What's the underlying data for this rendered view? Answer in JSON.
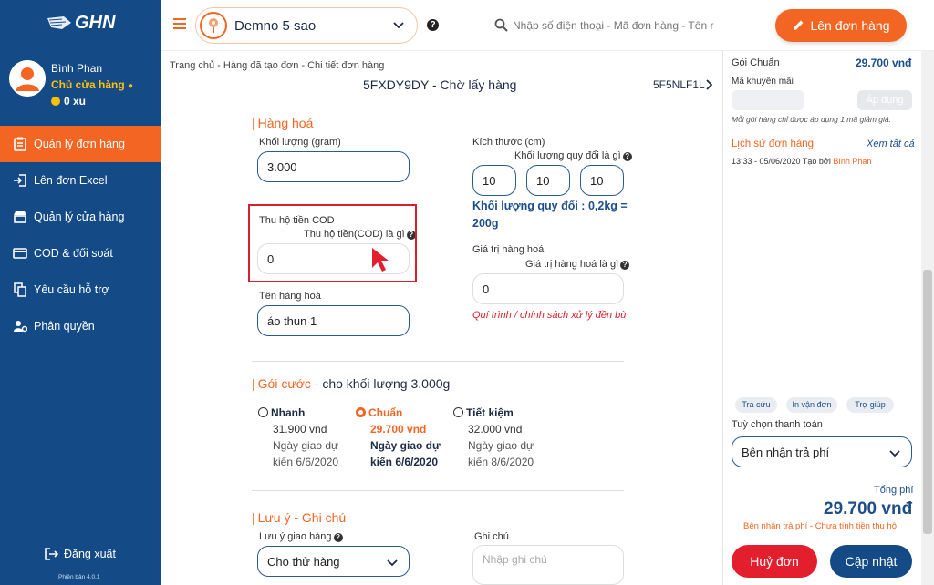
{
  "brand": {
    "logo_text": "GHN"
  },
  "profile": {
    "name": "Bình Phan",
    "role": "Chủ cửa hàng",
    "coins": "0 xu"
  },
  "sidebar": {
    "items": [
      {
        "label": "Quản lý đơn hàng",
        "icon": "clipboard-icon",
        "active": true
      },
      {
        "label": "Lên đơn Excel",
        "icon": "import-icon"
      },
      {
        "label": "Quản lý cửa hàng",
        "icon": "store-icon"
      },
      {
        "label": "COD & đối soát",
        "icon": "card-icon"
      },
      {
        "label": "Yêu cầu hỗ trợ",
        "icon": "documents-icon"
      },
      {
        "label": "Phân quyền",
        "icon": "users-gear-icon"
      }
    ],
    "logout": "Đăng xuất",
    "version": "Phiên bản 4.0.1"
  },
  "topbar": {
    "shop": "Demno 5 sao",
    "search_placeholder": "Nhập số điện thoại - Mã đơn hàng - Tên r",
    "create_button": "Lên đơn hàng"
  },
  "breadcrumb": "Trang chủ - Hàng đã tạo đơn - Chi tiết đơn hàng",
  "order": {
    "title": "5FXDY9DY - Chờ lấy hàng",
    "code": "5F5NLF1L"
  },
  "goods": {
    "section": "Hàng hoá",
    "weight_label": "Khối lượng (gram)",
    "weight_value": "3.000",
    "size_label": "Kích thước (cm)",
    "size_help": "Khối lượng quy đổi là gì",
    "dims": [
      "10",
      "10",
      "10"
    ],
    "converted_line1": "Khối lượng quy đổi : 0,2kg =",
    "converted_line2": "200g",
    "cod_label": "Thu hộ tiền COD",
    "cod_help": "Thu hộ tiền(COD) là gì",
    "cod_value": "0",
    "value_label": "Giá trị hàng hoá",
    "value_help": "Giá trị hàng hoá là gì",
    "value_value": "0",
    "policy_link": "Quí trình / chính sách xử lý đền bù",
    "name_label": "Tên hàng hoá",
    "name_value": "áo thun 1"
  },
  "packages": {
    "section_prefix": "Gói cước",
    "section_suffix": " - cho khối lượng 3.000g",
    "options": [
      {
        "name": "Nhanh",
        "price": "31.900 vnđ",
        "eta": "Ngày giao dự kiến 6/6/2020",
        "selected": false
      },
      {
        "name": "Chuẩn",
        "price": "29.700 vnđ",
        "eta": "Ngày giao dự kiến 6/6/2020",
        "selected": true
      },
      {
        "name": "Tiết kiệm",
        "price": "32.000 vnđ",
        "eta": "Ngày giao dự kiến 8/6/2020",
        "selected": false
      }
    ]
  },
  "notes": {
    "section": "Lưu ý - Ghi chú",
    "delivery_label": "Lưu ý giao hàng",
    "delivery_value": "Cho thử hàng",
    "note_label": "Ghi chú",
    "note_placeholder": "Nhập ghi chú"
  },
  "panel": {
    "package_name": "Gói Chuẩn",
    "package_price": "29.700 vnđ",
    "promo_label": "Mã khuyến mãi",
    "promo_button": "Áp dụng",
    "promo_note": "Mỗi gói hàng chỉ được áp dụng 1 mã giảm giá.",
    "history_title": "Lịch sử đơn hàng",
    "history_all": "Xem tất cả",
    "history_entry": "13:33 - 05/06/2020 Tạo bởi",
    "history_by": "Bình Phan",
    "chips": [
      "Tra cứu",
      "In vận đơn",
      "Trợ giúp"
    ],
    "payment_label": "Tuỳ chọn thanh toán",
    "payment_value": "Bên nhận trả phí",
    "total_label": "Tổng phí",
    "total_value": "29.700 vnđ",
    "total_note": "Bên nhận trả phí - Chưa tính tiền thu hộ",
    "cancel_button": "Huỷ đơn",
    "update_button": "Cập nhật"
  },
  "colors": {
    "primary": "#144b86",
    "accent": "#f26522",
    "danger": "#e31e2d"
  }
}
